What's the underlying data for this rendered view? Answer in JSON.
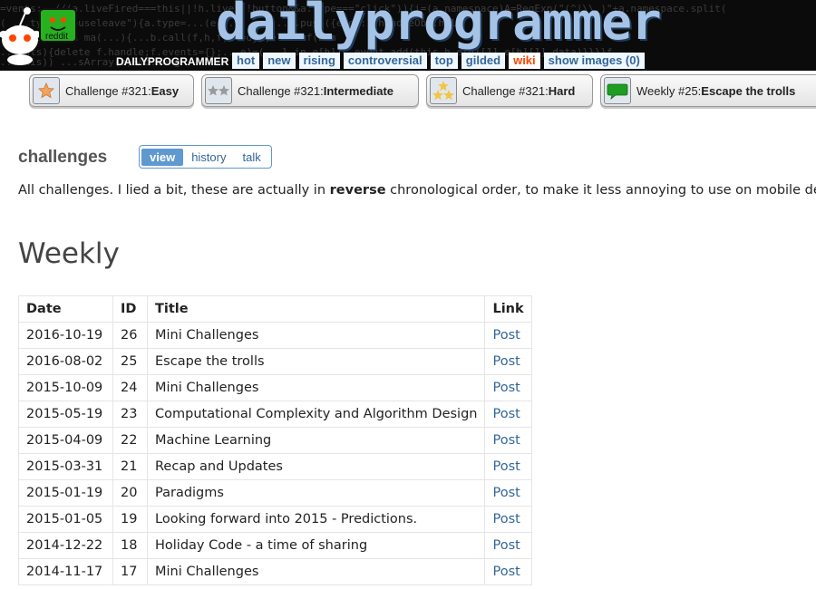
{
  "header": {
    "subreddit_title": "dailyprogrammer",
    "subreddit_name": "DAILYPROGRAMMER",
    "logo_text": "reddit",
    "code_lines": [
      "=vents: .//(a.liveFired===this||!h.live||!button&&a.type===\"click\")){i=(a.namespace)A=RegExp(\"(^|\\\\.)\"+a.namespace.split(",
      "( ...type=\"mouseleave\"){a.type=...(e[...]...)...C.push({elem:1,handleObj:h,li",
      "\"&\")}function ma(...){...b.call(f,h,f)===d});else if(b.n",
      "...ents){delete f.handle;f.events={};...e)=(...l in e[h])c.event.add(this,h,e[h][1],e[h][1].data)}}}}f",
      "...this)) ...sArray(b)&&b.leng"
    ],
    "tabs": [
      {
        "label": "hot",
        "selected": false
      },
      {
        "label": "new",
        "selected": false
      },
      {
        "label": "rising",
        "selected": false
      },
      {
        "label": "controversial",
        "selected": false
      },
      {
        "label": "top",
        "selected": false
      },
      {
        "label": "gilded",
        "selected": false
      },
      {
        "label": "wiki",
        "selected": true
      },
      {
        "label": "show images (0)",
        "selected": false
      }
    ]
  },
  "challenge_buttons": [
    {
      "prefix": "Challenge #321: ",
      "bold": "Easy",
      "icon": "star-icon"
    },
    {
      "prefix": "Challenge #321: ",
      "bold": "Intermediate",
      "icon": "two-stars-icon"
    },
    {
      "prefix": "Challenge #321: ",
      "bold": "Hard",
      "icon": "three-stars-icon"
    },
    {
      "prefix": "Weekly #25: ",
      "bold": "Escape the trolls",
      "icon": "chat-bubble-icon"
    }
  ],
  "wiki": {
    "page_title": "challenges",
    "tabs": [
      {
        "label": "view",
        "active": true
      },
      {
        "label": "history",
        "active": false
      },
      {
        "label": "talk",
        "active": false
      }
    ],
    "intro_before": "All challenges. I lied a bit, these are actually in ",
    "intro_bold": "reverse",
    "intro_after": " chronological order, to make it less annoying to use on mobile devic",
    "section_title": "Weekly"
  },
  "table": {
    "headers": [
      "Date",
      "ID",
      "Title",
      "Link"
    ],
    "rows": [
      [
        "2016-10-19",
        "26",
        "Mini Challenges",
        "Post"
      ],
      [
        "2016-08-02",
        "25",
        "Escape the trolls",
        "Post"
      ],
      [
        "2015-10-09",
        "24",
        "Mini Challenges",
        "Post"
      ],
      [
        "2015-05-19",
        "23",
        "Computational Complexity and Algorithm Design",
        "Post"
      ],
      [
        "2015-04-09",
        "22",
        "Machine Learning",
        "Post"
      ],
      [
        "2015-03-31",
        "21",
        "Recap and Updates",
        "Post"
      ],
      [
        "2015-01-19",
        "20",
        "Paradigms",
        "Post"
      ],
      [
        "2015-01-05",
        "19",
        "Looking forward into 2015 - Predictions.",
        "Post"
      ],
      [
        "2014-12-22",
        "18",
        "Holiday Code - a time of sharing",
        "Post"
      ],
      [
        "2014-11-17",
        "17",
        "Mini Challenges",
        "Post"
      ]
    ]
  },
  "colors": {
    "link": "#336699",
    "selected_tab": "#ff4500",
    "header_bg": "#0b0b0b",
    "title_blue": "#a4c3e6",
    "view_tab_bg": "#5f99cf"
  }
}
